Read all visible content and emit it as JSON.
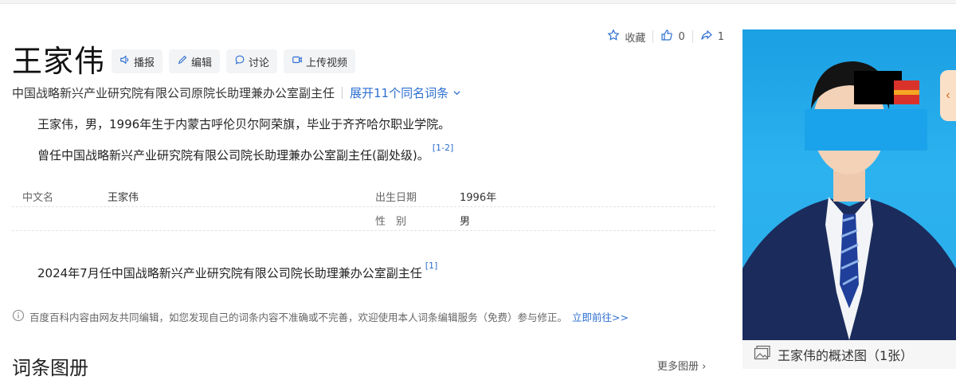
{
  "entry": {
    "title": "王家伟",
    "subtitle": "中国战略新兴产业研究院有限公司原院长助理兼办公室副主任",
    "expand_label": "展开11个同名词条"
  },
  "toolbar": {
    "broadcast": "播报",
    "edit": "编辑",
    "discuss": "讨论",
    "upload_video": "上传视频"
  },
  "actions": {
    "collect": "收藏",
    "like_count": "0",
    "share_count": "1"
  },
  "intro": {
    "p1": "王家伟，男，1996年生于内蒙古呼伦贝尔阿荣旗，毕业于齐齐哈尔职业学院。",
    "p2": "曾任中国战略新兴产业研究院有限公司院长助理兼办公室副主任(副处级)。",
    "p2_ref": "[1-2]"
  },
  "info": {
    "cn_name_label": "中文名",
    "cn_name": "王家伟",
    "birth_label": "出生日期",
    "birth": "1996年",
    "gender_label": "性　别",
    "gender": "男"
  },
  "career": {
    "text": "2024年7月任中国战略新兴产业研究院有限公司院长助理兼办公室副主任",
    "ref": "[1]"
  },
  "notice": {
    "text": "百度百科内容由网友共同编辑，如您发现自己的词条内容不准确或不完善，欢迎使用本人词条编辑服务（免费）参与修正。",
    "link": "立即前往>>"
  },
  "album": {
    "heading": "词条图册",
    "more": "更多图册"
  },
  "photo": {
    "caption": "王家伟的概述图（1张）"
  },
  "colors": {
    "link": "#2d6fd1",
    "photo_bg": "#24a8ea",
    "suit": "#1a2c5c"
  }
}
